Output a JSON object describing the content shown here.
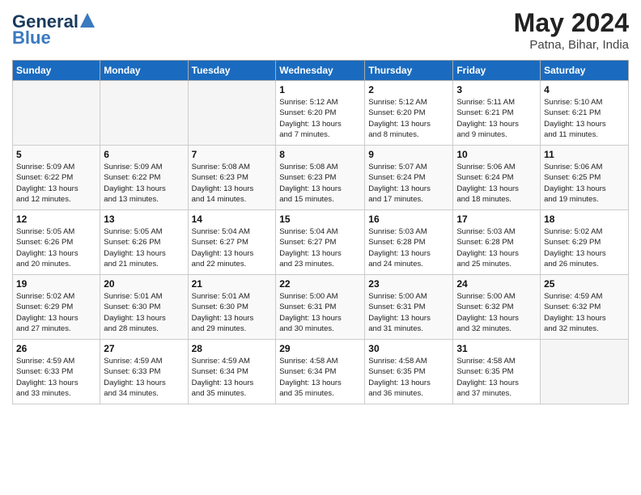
{
  "logo": {
    "line1": "General",
    "line2": "Blue"
  },
  "title": "May 2024",
  "location": "Patna, Bihar, India",
  "days_of_week": [
    "Sunday",
    "Monday",
    "Tuesday",
    "Wednesday",
    "Thursday",
    "Friday",
    "Saturday"
  ],
  "weeks": [
    [
      {
        "day": "",
        "info": ""
      },
      {
        "day": "",
        "info": ""
      },
      {
        "day": "",
        "info": ""
      },
      {
        "day": "1",
        "info": "Sunrise: 5:12 AM\nSunset: 6:20 PM\nDaylight: 13 hours\nand 7 minutes."
      },
      {
        "day": "2",
        "info": "Sunrise: 5:12 AM\nSunset: 6:20 PM\nDaylight: 13 hours\nand 8 minutes."
      },
      {
        "day": "3",
        "info": "Sunrise: 5:11 AM\nSunset: 6:21 PM\nDaylight: 13 hours\nand 9 minutes."
      },
      {
        "day": "4",
        "info": "Sunrise: 5:10 AM\nSunset: 6:21 PM\nDaylight: 13 hours\nand 11 minutes."
      }
    ],
    [
      {
        "day": "5",
        "info": "Sunrise: 5:09 AM\nSunset: 6:22 PM\nDaylight: 13 hours\nand 12 minutes."
      },
      {
        "day": "6",
        "info": "Sunrise: 5:09 AM\nSunset: 6:22 PM\nDaylight: 13 hours\nand 13 minutes."
      },
      {
        "day": "7",
        "info": "Sunrise: 5:08 AM\nSunset: 6:23 PM\nDaylight: 13 hours\nand 14 minutes."
      },
      {
        "day": "8",
        "info": "Sunrise: 5:08 AM\nSunset: 6:23 PM\nDaylight: 13 hours\nand 15 minutes."
      },
      {
        "day": "9",
        "info": "Sunrise: 5:07 AM\nSunset: 6:24 PM\nDaylight: 13 hours\nand 17 minutes."
      },
      {
        "day": "10",
        "info": "Sunrise: 5:06 AM\nSunset: 6:24 PM\nDaylight: 13 hours\nand 18 minutes."
      },
      {
        "day": "11",
        "info": "Sunrise: 5:06 AM\nSunset: 6:25 PM\nDaylight: 13 hours\nand 19 minutes."
      }
    ],
    [
      {
        "day": "12",
        "info": "Sunrise: 5:05 AM\nSunset: 6:26 PM\nDaylight: 13 hours\nand 20 minutes."
      },
      {
        "day": "13",
        "info": "Sunrise: 5:05 AM\nSunset: 6:26 PM\nDaylight: 13 hours\nand 21 minutes."
      },
      {
        "day": "14",
        "info": "Sunrise: 5:04 AM\nSunset: 6:27 PM\nDaylight: 13 hours\nand 22 minutes."
      },
      {
        "day": "15",
        "info": "Sunrise: 5:04 AM\nSunset: 6:27 PM\nDaylight: 13 hours\nand 23 minutes."
      },
      {
        "day": "16",
        "info": "Sunrise: 5:03 AM\nSunset: 6:28 PM\nDaylight: 13 hours\nand 24 minutes."
      },
      {
        "day": "17",
        "info": "Sunrise: 5:03 AM\nSunset: 6:28 PM\nDaylight: 13 hours\nand 25 minutes."
      },
      {
        "day": "18",
        "info": "Sunrise: 5:02 AM\nSunset: 6:29 PM\nDaylight: 13 hours\nand 26 minutes."
      }
    ],
    [
      {
        "day": "19",
        "info": "Sunrise: 5:02 AM\nSunset: 6:29 PM\nDaylight: 13 hours\nand 27 minutes."
      },
      {
        "day": "20",
        "info": "Sunrise: 5:01 AM\nSunset: 6:30 PM\nDaylight: 13 hours\nand 28 minutes."
      },
      {
        "day": "21",
        "info": "Sunrise: 5:01 AM\nSunset: 6:30 PM\nDaylight: 13 hours\nand 29 minutes."
      },
      {
        "day": "22",
        "info": "Sunrise: 5:00 AM\nSunset: 6:31 PM\nDaylight: 13 hours\nand 30 minutes."
      },
      {
        "day": "23",
        "info": "Sunrise: 5:00 AM\nSunset: 6:31 PM\nDaylight: 13 hours\nand 31 minutes."
      },
      {
        "day": "24",
        "info": "Sunrise: 5:00 AM\nSunset: 6:32 PM\nDaylight: 13 hours\nand 32 minutes."
      },
      {
        "day": "25",
        "info": "Sunrise: 4:59 AM\nSunset: 6:32 PM\nDaylight: 13 hours\nand 32 minutes."
      }
    ],
    [
      {
        "day": "26",
        "info": "Sunrise: 4:59 AM\nSunset: 6:33 PM\nDaylight: 13 hours\nand 33 minutes."
      },
      {
        "day": "27",
        "info": "Sunrise: 4:59 AM\nSunset: 6:33 PM\nDaylight: 13 hours\nand 34 minutes."
      },
      {
        "day": "28",
        "info": "Sunrise: 4:59 AM\nSunset: 6:34 PM\nDaylight: 13 hours\nand 35 minutes."
      },
      {
        "day": "29",
        "info": "Sunrise: 4:58 AM\nSunset: 6:34 PM\nDaylight: 13 hours\nand 35 minutes."
      },
      {
        "day": "30",
        "info": "Sunrise: 4:58 AM\nSunset: 6:35 PM\nDaylight: 13 hours\nand 36 minutes."
      },
      {
        "day": "31",
        "info": "Sunrise: 4:58 AM\nSunset: 6:35 PM\nDaylight: 13 hours\nand 37 minutes."
      },
      {
        "day": "",
        "info": ""
      }
    ]
  ]
}
